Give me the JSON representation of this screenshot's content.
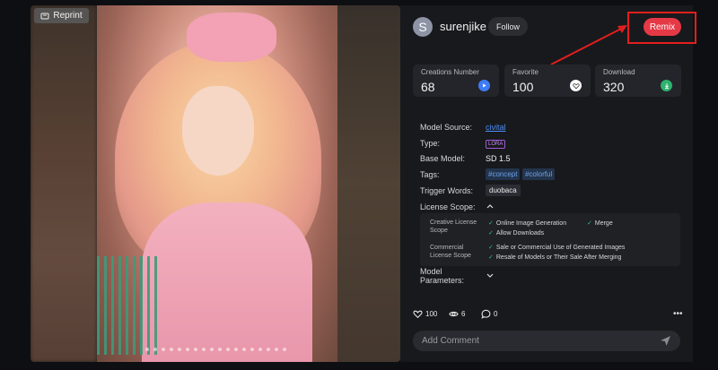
{
  "image_viewer": {
    "reprint_label": "Reprint",
    "slide_count": 18
  },
  "author": {
    "avatar_letter": "S",
    "username": "surenjike",
    "follow_label": "Follow"
  },
  "remix_label": "Remix",
  "stats": [
    {
      "label": "Creations Number",
      "value": "68",
      "icon": "play-icon"
    },
    {
      "label": "Favorite",
      "value": "100",
      "icon": "heart-icon"
    },
    {
      "label": "Download",
      "value": "320",
      "icon": "download-icon"
    }
  ],
  "details": {
    "model_source_label": "Model Source:",
    "model_source_value": "civital",
    "type_label": "Type:",
    "type_value": "LORA",
    "base_model_label": "Base Model:",
    "base_model_value": "SD 1.5",
    "tags_label": "Tags:",
    "tags": [
      "#concept",
      "#colorful"
    ],
    "trigger_label": "Trigger Words:",
    "trigger_value": "duobaca",
    "license_label": "License Scope:",
    "model_params_label_1": "Model",
    "model_params_label_2": "Parameters:"
  },
  "license": {
    "creative_label_1": "Creative License",
    "creative_label_2": "Scope",
    "online_generation": "Online Image Generation",
    "merge": "Merge",
    "allow_downloads": "Allow Downloads",
    "commercial_label_1": "Commercial",
    "commercial_label_2": "License Scope",
    "sale_commercial": "Sale or Commercial Use of Generated Images",
    "resale": "Resale of Models or Their Sale After Merging"
  },
  "actions": {
    "likes": "100",
    "views": "6",
    "comments": "0"
  },
  "comment": {
    "placeholder": "Add Comment"
  },
  "colors": {
    "remix": "#e53945",
    "annotation": "#e21e1e",
    "link": "#4c8df6",
    "check": "#2ec27e",
    "play_icon_bg": "#3f7cf6",
    "download_icon_bg": "#2fb26e"
  }
}
